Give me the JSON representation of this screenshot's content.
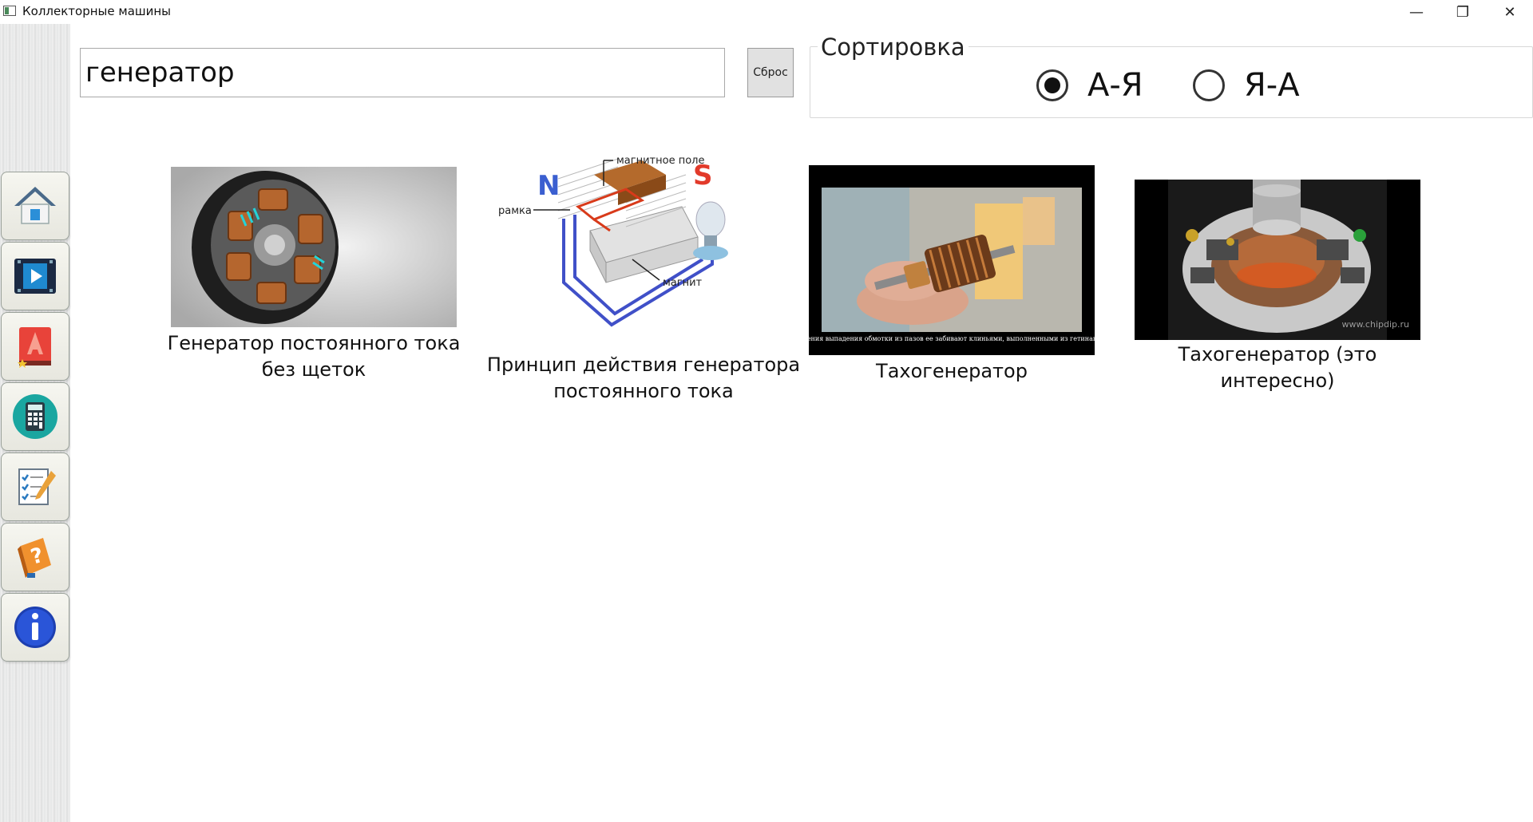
{
  "window": {
    "title": "Коллекторные машины",
    "minimize_glyph": "—",
    "maximize_glyph": "❐",
    "close_glyph": "✕"
  },
  "sidebar": {
    "items": [
      {
        "icon": "home-icon"
      },
      {
        "icon": "video-icon"
      },
      {
        "icon": "book-icon"
      },
      {
        "icon": "calculator-icon"
      },
      {
        "icon": "test-icon"
      },
      {
        "icon": "help-icon"
      },
      {
        "icon": "info-icon"
      }
    ]
  },
  "search": {
    "value": "генератор",
    "reset_label": "Сброс"
  },
  "sort": {
    "legend": "Сортировка",
    "options": [
      {
        "label": "А-Я",
        "selected": true
      },
      {
        "label": "Я-А",
        "selected": false
      }
    ]
  },
  "results": [
    {
      "caption": "Генератор постоянного тока\nбез щеток"
    },
    {
      "caption": "Принцип действия генератора\nпостоянного тока",
      "labels": {
        "field": "магнитное поле",
        "frame": "рамка",
        "magnet": "магнит",
        "north": "N",
        "south": "S"
      }
    },
    {
      "caption": "Тахогенератор",
      "subtitle": "Для предотвращения выпадения обмотки из пазов ее забивают клиньями, выполненными из гетинакса и текстолита."
    },
    {
      "caption": "Тахогенератор (это интересно)",
      "watermark": "www.chipdip.ru"
    }
  ]
}
